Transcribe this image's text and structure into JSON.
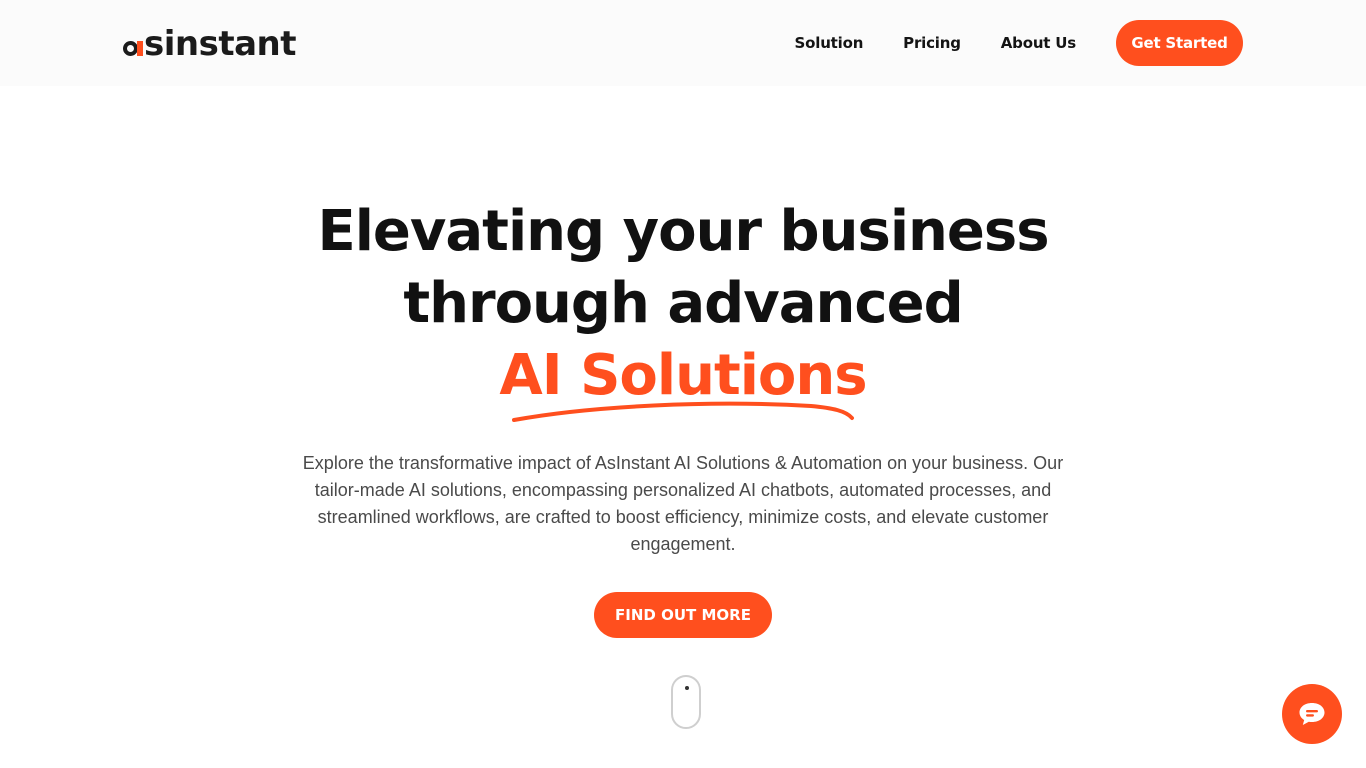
{
  "brand": {
    "logo_text": "sinstant",
    "accent_color": "#ff4f1e"
  },
  "nav": {
    "items": [
      {
        "label": "Solution"
      },
      {
        "label": "Pricing"
      },
      {
        "label": "About Us"
      }
    ],
    "cta_label": "Get Started"
  },
  "hero": {
    "title_line1": "Elevating your business",
    "title_line2": "through advanced",
    "title_accent": "AI Solutions",
    "description": "Explore the transformative impact of AsInstant AI Solutions & Automation on your business. Our tailor-made AI solutions, encompassing personalized AI chatbots, automated processes, and streamlined workflows, are crafted to boost efficiency, minimize costs, and elevate customer engagement.",
    "button_label": "FIND OUT MORE"
  },
  "icons": {
    "scroll": "mouse-scroll-icon",
    "chat": "chat-bubble-icon"
  }
}
